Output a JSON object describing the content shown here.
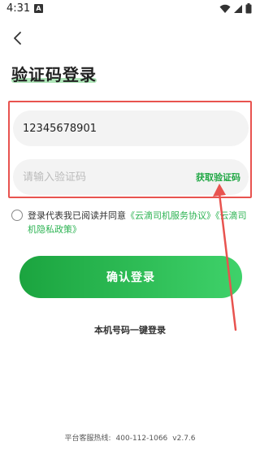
{
  "status_bar": {
    "time": "4:31",
    "notif_icon_letter": "A"
  },
  "header": {
    "title": "验证码登录"
  },
  "form": {
    "phone_value": "12345678901",
    "code_placeholder": "请输入验证码",
    "get_code_label": "获取验证码"
  },
  "agreement": {
    "text": "登录代表我已阅读并同意",
    "service_link": "《云滴司机服务协议》",
    "privacy_link": "《云滴司机隐私政策》"
  },
  "actions": {
    "confirm_label": "确认登录",
    "one_click_label": "本机号码一键登录"
  },
  "footer": {
    "hotline_label": "平台客服热线:",
    "hotline_number": "400-112-1066",
    "version": "v2.7.6"
  },
  "colors": {
    "accent_green": "#22a846",
    "annotation_red": "#e8534f"
  },
  "icons": [
    "back-arrow-icon",
    "wifi-icon",
    "signal-icon",
    "battery-icon"
  ]
}
